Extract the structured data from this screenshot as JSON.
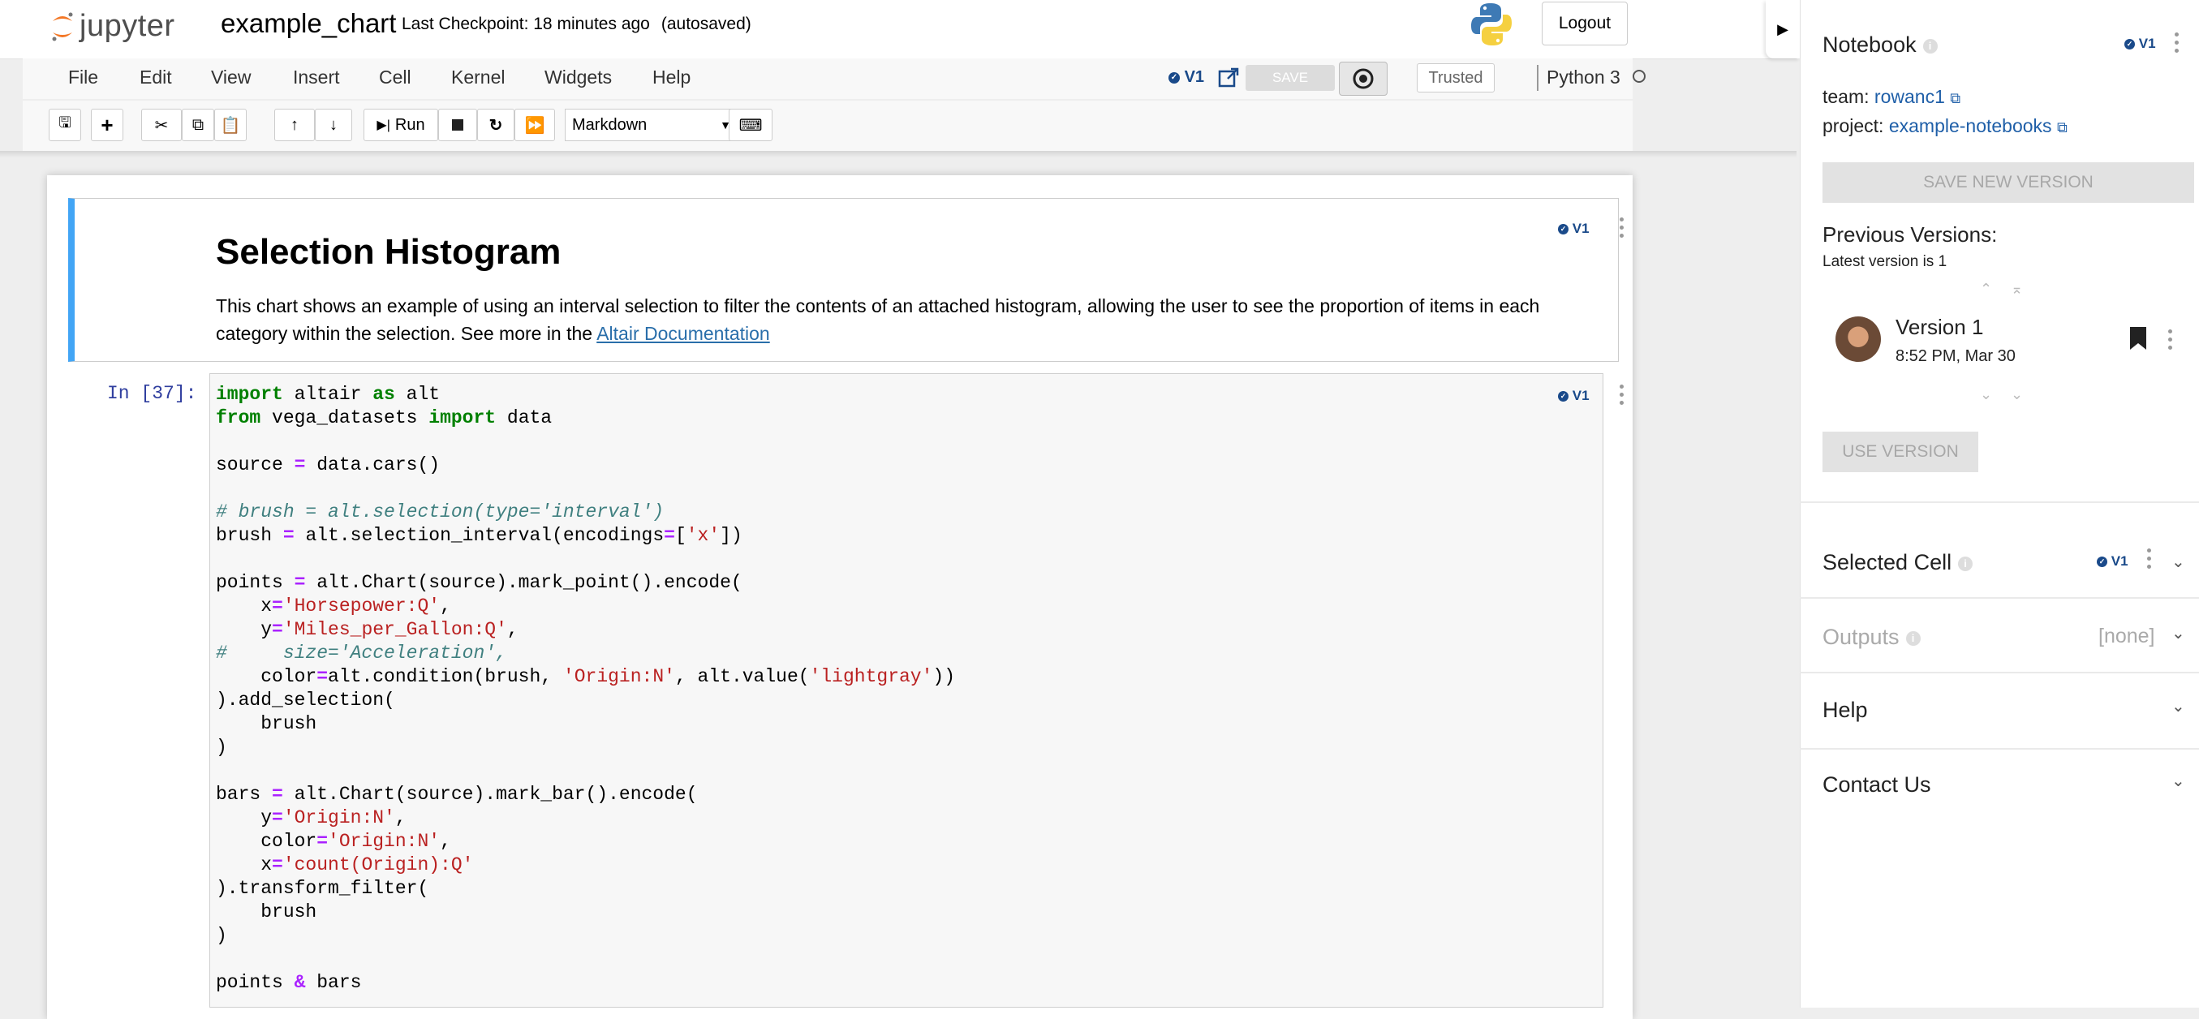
{
  "header": {
    "logo_text": "jupyter",
    "notebook_name": "example_chart",
    "checkpoint": "Last Checkpoint: 18 minutes ago",
    "autosaved": "(autosaved)",
    "logout": "Logout"
  },
  "menubar": {
    "items": [
      "File",
      "Edit",
      "View",
      "Insert",
      "Cell",
      "Kernel",
      "Widgets",
      "Help"
    ],
    "version_badge": "V1",
    "save_label": "SAVE",
    "trusted": "Trusted",
    "kernel": "Python 3"
  },
  "toolbar": {
    "run_label": "Run",
    "cell_type": "Markdown"
  },
  "markdown_cell": {
    "title": "Selection Histogram",
    "text_before_link": "This chart shows an example of using an interval selection to filter the contents of an attached histogram, allowing the user to see the proportion of items in each category within the selection. See more in the ",
    "link_text": "Altair Documentation",
    "version_badge": "V1"
  },
  "code_cell": {
    "prompt": "In [37]:",
    "version_badge": "V1",
    "lines": [
      "import altair as alt",
      "from vega_datasets import data",
      "",
      "source = data.cars()",
      "",
      "# brush = alt.selection(type='interval')",
      "brush = alt.selection_interval(encodings=['x'])",
      "",
      "points = alt.Chart(source).mark_point().encode(",
      "    x='Horsepower:Q',",
      "    y='Miles_per_Gallon:Q',",
      "#     size='Acceleration',",
      "    color=alt.condition(brush, 'Origin:N', alt.value('lightgray'))",
      ").add_selection(",
      "    brush",
      ")",
      "",
      "bars = alt.Chart(source).mark_bar().encode(",
      "    y='Origin:N',",
      "    color='Origin:N',",
      "    x='count(Origin):Q'",
      ").transform_filter(",
      "    brush",
      ")",
      "",
      "points & bars"
    ]
  },
  "right_panel": {
    "notebook_title": "Notebook",
    "version_badge": "V1",
    "team_label": "team:",
    "team_value": "rowanc1",
    "project_label": "project:",
    "project_value": "example-notebooks",
    "save_new_version": "SAVE NEW VERSION",
    "previous_versions": "Previous Versions:",
    "latest_version": "Latest version is 1",
    "version_name": "Version 1",
    "version_date": "8:52 PM, Mar 30",
    "use_version": "USE VERSION",
    "selected_cell": "Selected Cell",
    "selected_cell_badge": "V1",
    "outputs": "Outputs",
    "outputs_value": "[none]",
    "help": "Help",
    "contact": "Contact Us"
  },
  "colors": {
    "accent_blue": "#42a5f5",
    "link_blue": "#1f5fa8",
    "version_blue": "#1a4a8a"
  }
}
